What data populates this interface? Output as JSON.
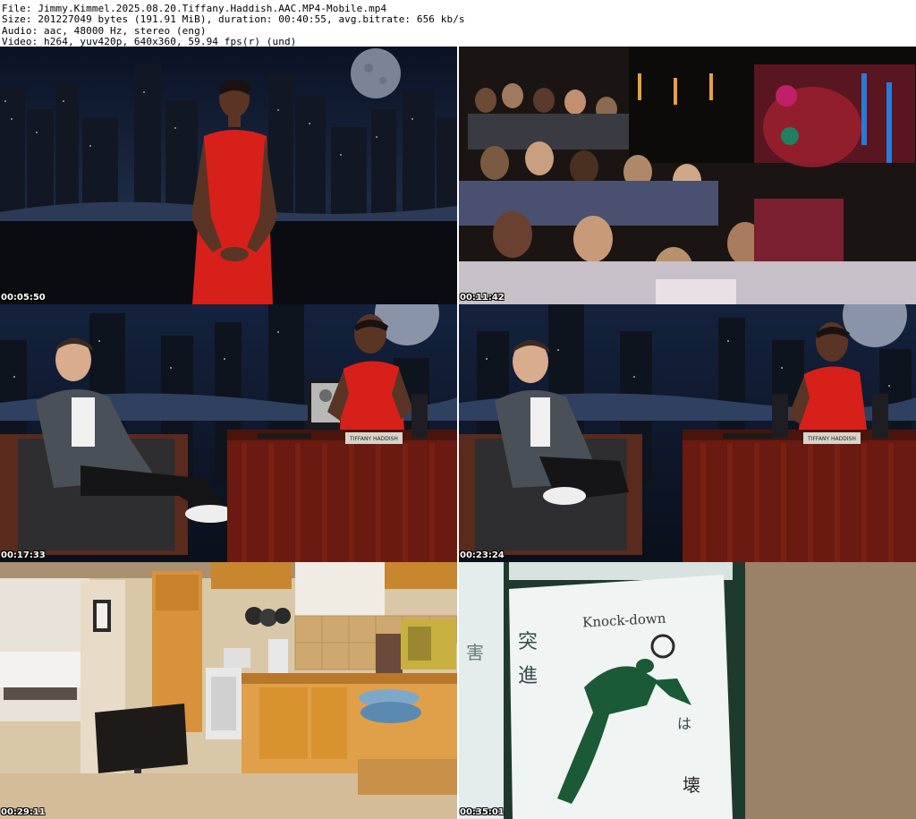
{
  "header": {
    "file_line": "File: Jimmy.Kimmel.2025.08.20.Tiffany.Haddish.AAC.MP4-Mobile.mp4",
    "size_line": "Size: 201227049 bytes (191.91 MiB), duration: 00:40:55, avg.bitrate: 656 kb/s",
    "audio_line": "Audio: aac, 48000 Hz, stereo (eng)",
    "video_line": "Video: h264, yuv420p, 640x360, 59.94 fps(r) (und)"
  },
  "thumbnails": [
    {
      "timestamp": "00:05:50"
    },
    {
      "timestamp": "00:11:42"
    },
    {
      "timestamp": "00:17:33",
      "nameplate": "TIFFANY HADDISH"
    },
    {
      "timestamp": "00:23:24",
      "nameplate": "TIFFANY HADDISH"
    },
    {
      "timestamp": "00:29:11"
    },
    {
      "timestamp": "00:35:01",
      "sign_text": "Knock-down"
    }
  ]
}
